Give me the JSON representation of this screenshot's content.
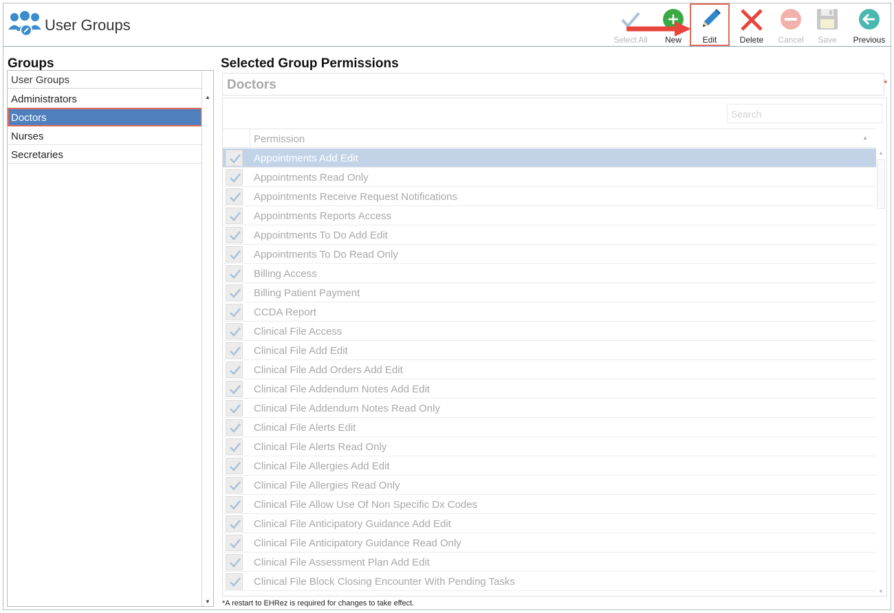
{
  "header": {
    "title": "User Groups",
    "app_icon": "user-groups-icon"
  },
  "toolbar": {
    "select_all": "Select All",
    "new": "New",
    "edit": "Edit",
    "delete": "Delete",
    "cancel": "Cancel",
    "save": "Save",
    "previous": "Previous"
  },
  "groups": {
    "title": "Groups",
    "column_header": "User Groups",
    "items": [
      "Administrators",
      "Doctors",
      "Nurses",
      "Secretaries"
    ],
    "selected": "Doctors"
  },
  "permissions": {
    "title": "Selected Group Permissions",
    "group_name": "Doctors",
    "required_mark": "*",
    "search_placeholder": "Search",
    "column_header": "Permission",
    "rows": [
      "Appointments Add Edit",
      "Appointments Read Only",
      "Appointments Receive Request Notifications",
      "Appointments Reports Access",
      "Appointments To Do Add Edit",
      "Appointments To Do Read Only",
      "Billing Access",
      "Billing Patient Payment",
      "CCDA Report",
      "Clinical File Access",
      "Clinical File Add Edit",
      "Clinical File Add Orders Add Edit",
      "Clinical File Addendum Notes Add Edit",
      "Clinical File Addendum Notes Read Only",
      "Clinical File Alerts Edit",
      "Clinical File Alerts Read Only",
      "Clinical File Allergies Add Edit",
      "Clinical File Allergies Read Only",
      "Clinical File Allow Use Of Non Specific Dx Codes",
      "Clinical File Anticipatory Guidance Add Edit",
      "Clinical File Anticipatory Guidance Read Only",
      "Clinical File Assessment Plan Add Edit",
      "Clinical File Block Closing Encounter With Pending Tasks"
    ],
    "selected_row": "Appointments Add Edit"
  },
  "footer": {
    "note": "*A restart to EHRez is required for changes to take effect."
  },
  "colors": {
    "selected_group": "#4f7fbd",
    "selected_row": "#c3d3e7",
    "highlight_outline": "#e36b5a",
    "new_green": "#3aa843",
    "delete_red": "#e8453c",
    "previous_teal": "#4ab8b0",
    "edit_blue": "#2f86c8"
  }
}
